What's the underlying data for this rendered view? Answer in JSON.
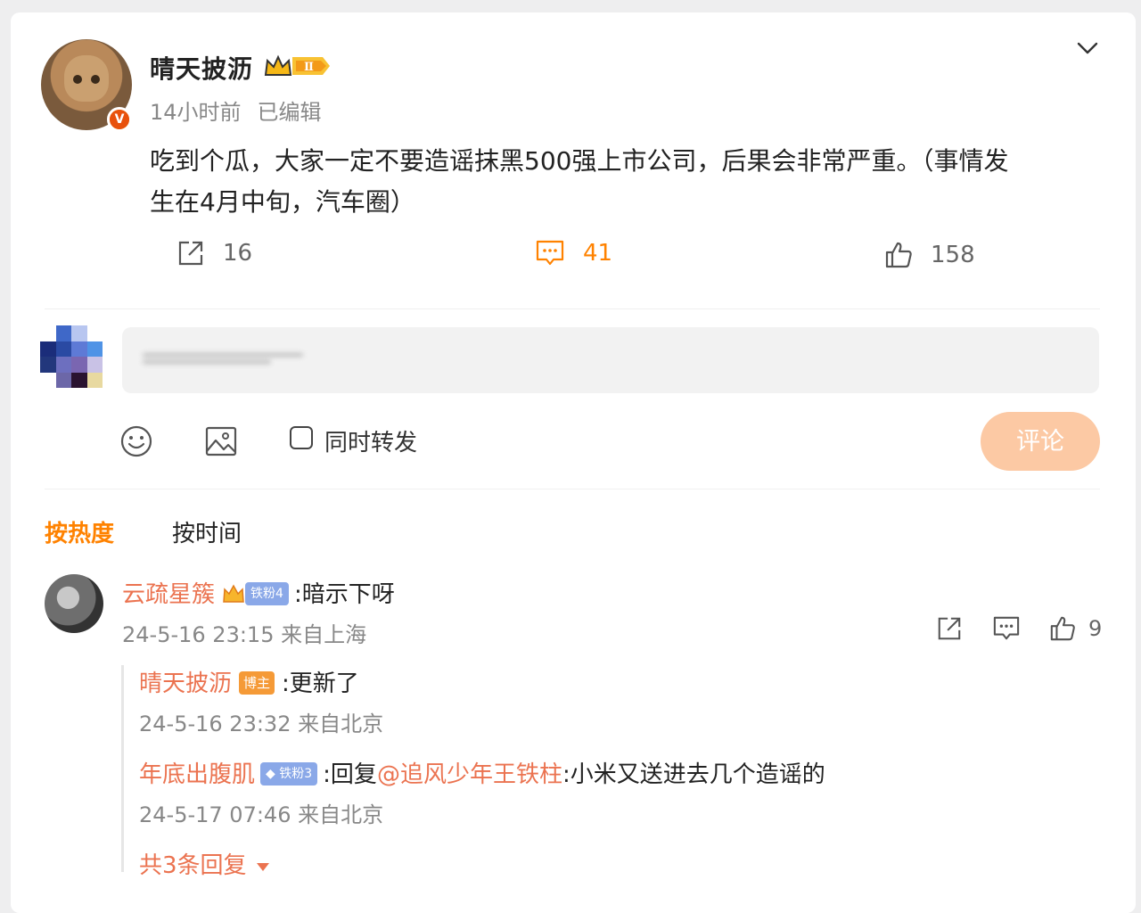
{
  "post": {
    "author": "晴天披沥",
    "badge_level": "Ⅱ",
    "time": "14小时前",
    "edited": "已编辑",
    "text_line1": "吃到个瓜，大家一定不要造谣抹黑500强上市公司，后果会非常严重。（事情发",
    "text_line2": "生在4月中旬，汽车圈）",
    "verified_mark": "V",
    "repost_count": "16",
    "comment_count": "41",
    "like_count": "158"
  },
  "composer": {
    "repost_checkbox_label": "同时转发",
    "submit_label": "评论"
  },
  "sort_tabs": {
    "hot": "按热度",
    "time": "按时间"
  },
  "comments": [
    {
      "name": "云疏星簇",
      "fan_badge": "铁粉4",
      "text": ":暗示下呀",
      "time": "24-5-16 23:15 来自上海",
      "like_count": "9",
      "replies": [
        {
          "name": "晴天披沥",
          "badge": "博主",
          "text": ":更新了",
          "time": "24-5-16 23:32 来自北京"
        },
        {
          "name": "年底出腹肌",
          "fan_badge": "铁粉3",
          "prefix": ":回复",
          "mention": "@追风少年王铁柱",
          "text": ":小米又送进去几个造谣的",
          "time": "24-5-17 07:46 来自北京"
        }
      ],
      "more_replies": "共3条回复"
    }
  ],
  "colors": {
    "accent": "#ff8200",
    "name": "#eb7350",
    "submit_disabled": "#fcc9a4"
  }
}
